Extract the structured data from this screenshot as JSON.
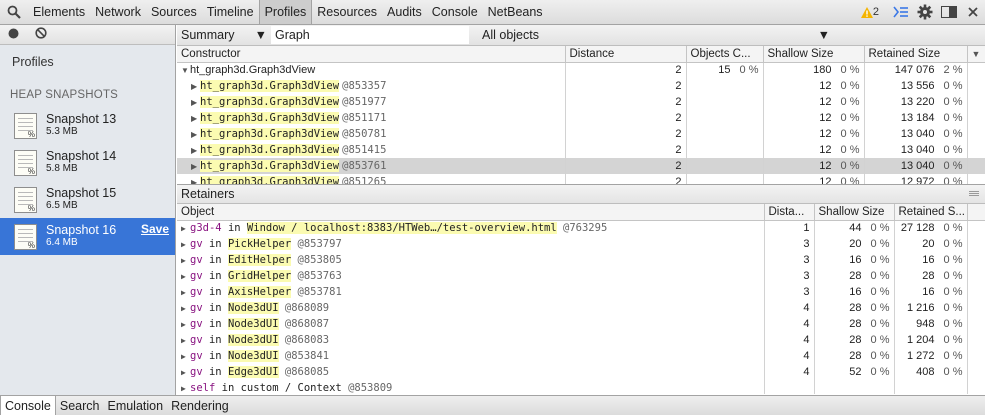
{
  "toolbar": {
    "tabs": [
      "Elements",
      "Network",
      "Sources",
      "Timeline",
      "Profiles",
      "Resources",
      "Audits",
      "Console",
      "NetBeans"
    ],
    "active_tab": "Profiles",
    "warning_count": "2"
  },
  "sidebar": {
    "title": "Profiles",
    "section_title": "HEAP SNAPSHOTS",
    "snapshots": [
      {
        "title": "Snapshot 13",
        "size": "5.3 MB"
      },
      {
        "title": "Snapshot 14",
        "size": "5.8 MB"
      },
      {
        "title": "Snapshot 15",
        "size": "6.5 MB"
      },
      {
        "title": "Snapshot 16",
        "size": "6.4 MB",
        "action": "Save"
      }
    ]
  },
  "filterbar": {
    "view": "Summary",
    "class_filter": "Graph",
    "objects": "All objects"
  },
  "constructors": {
    "headers": [
      "Constructor",
      "Distance",
      "Objects C...",
      "Shallow Size",
      "Retained Size"
    ],
    "parent": {
      "name": "ht_graph3d.Graph3dView",
      "distance": "2",
      "count": "15",
      "count_pct": "0 %",
      "shallow": "180",
      "shallow_pct": "0 %",
      "retained": "147 076",
      "retained_pct": "2 %"
    },
    "rows": [
      {
        "name": "ht_graph3d.Graph3dView",
        "id": "@853357",
        "distance": "2",
        "shallow": "12",
        "shallow_pct": "0 %",
        "retained": "13 556",
        "retained_pct": "0 %"
      },
      {
        "name": "ht_graph3d.Graph3dView",
        "id": "@851977",
        "distance": "2",
        "shallow": "12",
        "shallow_pct": "0 %",
        "retained": "13 220",
        "retained_pct": "0 %"
      },
      {
        "name": "ht_graph3d.Graph3dView",
        "id": "@851171",
        "distance": "2",
        "shallow": "12",
        "shallow_pct": "0 %",
        "retained": "13 184",
        "retained_pct": "0 %"
      },
      {
        "name": "ht_graph3d.Graph3dView",
        "id": "@850781",
        "distance": "2",
        "shallow": "12",
        "shallow_pct": "0 %",
        "retained": "13 040",
        "retained_pct": "0 %"
      },
      {
        "name": "ht_graph3d.Graph3dView",
        "id": "@851415",
        "distance": "2",
        "shallow": "12",
        "shallow_pct": "0 %",
        "retained": "13 040",
        "retained_pct": "0 %"
      },
      {
        "name": "ht_graph3d.Graph3dView",
        "id": "@853761",
        "distance": "2",
        "shallow": "12",
        "shallow_pct": "0 %",
        "retained": "13 040",
        "retained_pct": "0 %"
      },
      {
        "name": "ht_graph3d.Graph3dView",
        "id": "@851265",
        "distance": "2",
        "shallow": "12",
        "shallow_pct": "0 %",
        "retained": "12 972",
        "retained_pct": "0 %"
      }
    ],
    "selected_index": 5
  },
  "retainers": {
    "title": "Retainers",
    "headers": [
      "Object",
      "Dista...",
      "Shallow Size",
      "Retained S..."
    ],
    "rows": [
      {
        "prop": "g3d-4",
        "kw": "in",
        "target": "Window / localhost:8383/HTWeb…/test-overview.html",
        "id": "@763295",
        "distance": "1",
        "shallow": "44",
        "shallow_pct": "0 %",
        "retained": "27 128",
        "retained_pct": "0 %"
      },
      {
        "prop": "gv",
        "kw": "in",
        "target": "PickHelper",
        "id": "@853797",
        "distance": "3",
        "shallow": "20",
        "shallow_pct": "0 %",
        "retained": "20",
        "retained_pct": "0 %"
      },
      {
        "prop": "gv",
        "kw": "in",
        "target": "EditHelper",
        "id": "@853805",
        "distance": "3",
        "shallow": "16",
        "shallow_pct": "0 %",
        "retained": "16",
        "retained_pct": "0 %"
      },
      {
        "prop": "gv",
        "kw": "in",
        "target": "GridHelper",
        "id": "@853763",
        "distance": "3",
        "shallow": "28",
        "shallow_pct": "0 %",
        "retained": "28",
        "retained_pct": "0 %"
      },
      {
        "prop": "gv",
        "kw": "in",
        "target": "AxisHelper",
        "id": "@853781",
        "distance": "3",
        "shallow": "16",
        "shallow_pct": "0 %",
        "retained": "16",
        "retained_pct": "0 %"
      },
      {
        "prop": "gv",
        "kw": "in",
        "target": "Node3dUI",
        "id": "@868089",
        "distance": "4",
        "shallow": "28",
        "shallow_pct": "0 %",
        "retained": "1 216",
        "retained_pct": "0 %"
      },
      {
        "prop": "gv",
        "kw": "in",
        "target": "Node3dUI",
        "id": "@868087",
        "distance": "4",
        "shallow": "28",
        "shallow_pct": "0 %",
        "retained": "948",
        "retained_pct": "0 %"
      },
      {
        "prop": "gv",
        "kw": "in",
        "target": "Node3dUI",
        "id": "@868083",
        "distance": "4",
        "shallow": "28",
        "shallow_pct": "0 %",
        "retained": "1 204",
        "retained_pct": "0 %"
      },
      {
        "prop": "gv",
        "kw": "in",
        "target": "Node3dUI",
        "id": "@853841",
        "distance": "4",
        "shallow": "28",
        "shallow_pct": "0 %",
        "retained": "1 272",
        "retained_pct": "0 %"
      },
      {
        "prop": "gv",
        "kw": "in",
        "target": "Edge3dUI",
        "id": "@868085",
        "distance": "4",
        "shallow": "52",
        "shallow_pct": "0 %",
        "retained": "408",
        "retained_pct": "0 %"
      },
      {
        "prop": "self",
        "kw": "in",
        "target": "custom / Context",
        "id": "@853809",
        "distance": "",
        "shallow": "",
        "shallow_pct": "",
        "retained": "",
        "retained_pct": ""
      }
    ]
  },
  "drawer": {
    "tabs": [
      "Console",
      "Search",
      "Emulation",
      "Rendering"
    ],
    "active_tab": "Console"
  },
  "colors": {
    "selection": "#3875d7",
    "highlight": "#fbfbb1",
    "property": "#881280",
    "warning": "#f4b400",
    "console_icon": "#3b78e7"
  }
}
